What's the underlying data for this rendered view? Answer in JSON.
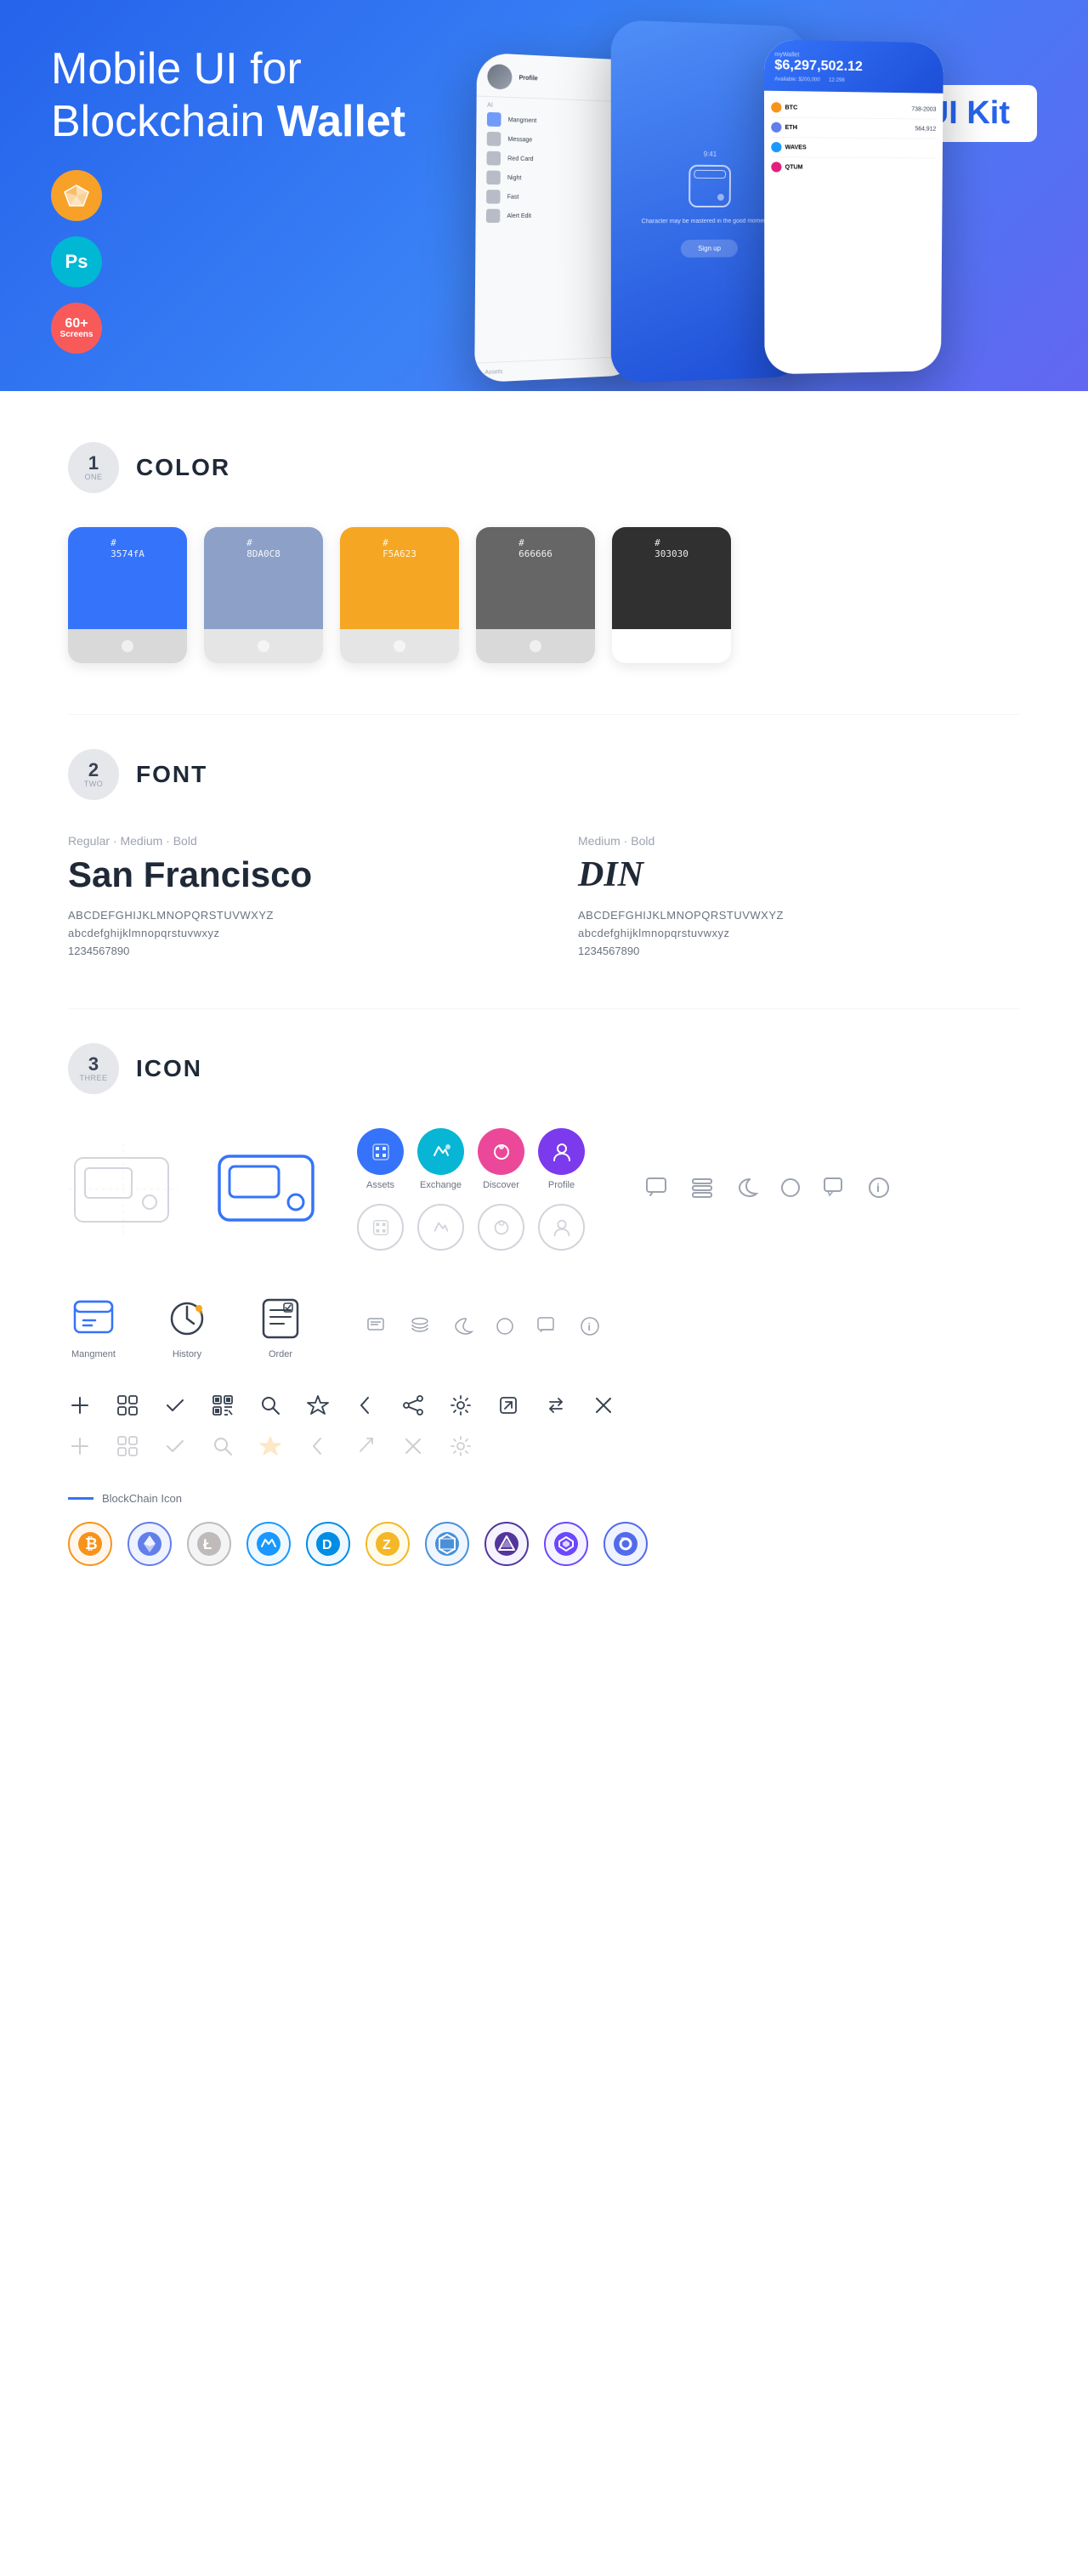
{
  "hero": {
    "title": "Mobile UI for Blockchain ",
    "title_bold": "Wallet",
    "ui_kit_label": "UI Kit",
    "badges": [
      {
        "id": "sketch",
        "label": "Sk",
        "color": "#f7a128"
      },
      {
        "id": "ps",
        "label": "Ps",
        "color": "#00b8d4"
      },
      {
        "id": "screens",
        "line1": "60+",
        "line2": "Screens",
        "color": "#f85a5a"
      }
    ]
  },
  "sections": {
    "color": {
      "number": "1",
      "word": "ONE",
      "title": "COLOR",
      "swatches": [
        {
          "id": "blue",
          "hex": "#3574FA",
          "hex_display": "#\n3574fA",
          "bg": "#3574FA"
        },
        {
          "id": "gray-blue",
          "hex": "#8D A0C8",
          "hex_display": "#\n8DA0C8",
          "bg": "#8DA0C8"
        },
        {
          "id": "yellow",
          "hex": "#F5A623",
          "hex_display": "#\nF5A623",
          "bg": "#F5A623"
        },
        {
          "id": "mid-gray",
          "hex": "#666666",
          "hex_display": "#\n666666",
          "bg": "#666666"
        },
        {
          "id": "dark",
          "hex": "#303030",
          "hex_display": "#\n303030",
          "bg": "#303030"
        }
      ]
    },
    "font": {
      "number": "2",
      "word": "TWO",
      "title": "FONT",
      "fonts": [
        {
          "id": "sf",
          "style": "Regular · Medium · Bold",
          "name": "San Francisco",
          "uppercase": "ABCDEFGHIJKLMNOPQRSTUVWXYZ",
          "lowercase": "abcdefghijklmnopqrstuvwxyz",
          "numbers": "1234567890"
        },
        {
          "id": "din",
          "style": "Medium · Bold",
          "name": "DIN",
          "uppercase": "ABCDEFGHIJKLMNOPQRSTUVWXYZ",
          "lowercase": "abcdefghijklmnopqrstuvwxyz",
          "numbers": "1234567890"
        }
      ]
    },
    "icon": {
      "number": "3",
      "word": "THREE",
      "title": "ICON",
      "app_icons": [
        {
          "id": "assets",
          "label": "Assets",
          "color": "#3574FA"
        },
        {
          "id": "exchange",
          "label": "Exchange",
          "color": "#2dd4bf"
        },
        {
          "id": "discover",
          "label": "Discover",
          "color": "#f472b6"
        },
        {
          "id": "profile",
          "label": "Profile",
          "color": "#8b5cf6"
        }
      ],
      "management_icons": [
        {
          "id": "management",
          "label": "Mangment"
        },
        {
          "id": "history",
          "label": "History"
        },
        {
          "id": "order",
          "label": "Order"
        }
      ],
      "tool_icons": [
        "plus",
        "grid-edit",
        "check",
        "qr-code",
        "search",
        "star",
        "chevron-left",
        "share",
        "settings",
        "arrow-up-right",
        "transfer",
        "close"
      ],
      "blockchain_label": "BlockChain Icon",
      "crypto_icons": [
        {
          "id": "bitcoin",
          "symbol": "₿",
          "color": "#f7931a",
          "bg": "#fff7ed"
        },
        {
          "id": "ethereum",
          "symbol": "Ξ",
          "color": "#627eea",
          "bg": "#eff2ff"
        },
        {
          "id": "litecoin",
          "symbol": "Ł",
          "color": "#bfbbbb",
          "bg": "#f3f4f6"
        },
        {
          "id": "waves",
          "symbol": "〜",
          "color": "#1a98ff",
          "bg": "#eff8ff"
        },
        {
          "id": "dash",
          "symbol": "D",
          "color": "#008de4",
          "bg": "#eff8ff"
        },
        {
          "id": "zcash",
          "symbol": "Z",
          "color": "#f4b728",
          "bg": "#fffbeb"
        },
        {
          "id": "grid-coin",
          "symbol": "⬡",
          "color": "#4a90d9",
          "bg": "#eff6ff"
        },
        {
          "id": "augur",
          "symbol": "▲",
          "color": "#53369b",
          "bg": "#f5f3ff"
        },
        {
          "id": "ark",
          "symbol": "◆",
          "color": "#6b48ff",
          "bg": "#f5f3ff"
        },
        {
          "id": "band",
          "symbol": "◉",
          "color": "#516beb",
          "bg": "#eff2ff"
        }
      ]
    }
  }
}
